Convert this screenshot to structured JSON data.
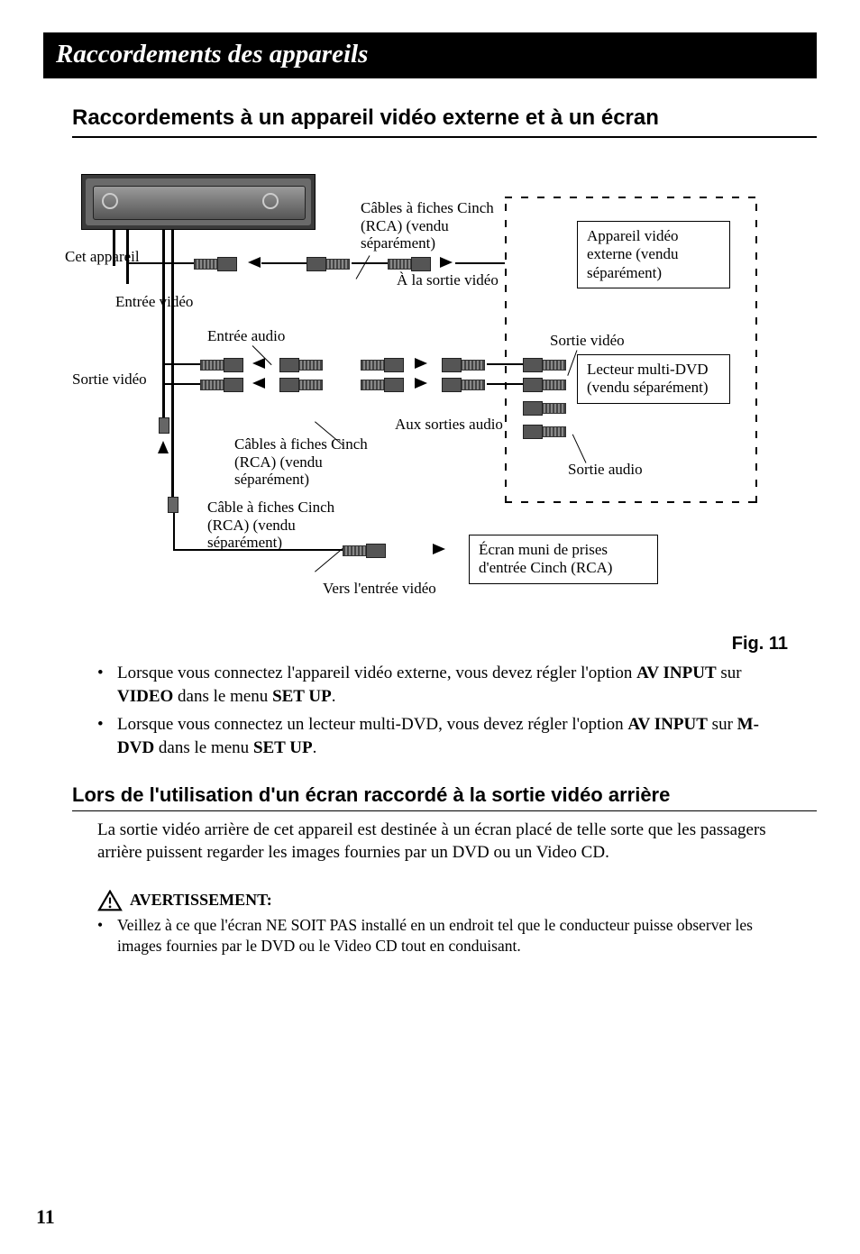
{
  "banner": "Raccordements des appareils",
  "heading1": "Raccordements à un appareil vidéo externe et à un écran",
  "diagram": {
    "this_unit": "Cet appareil",
    "video_in": "Entrée vidéo",
    "audio_in": "Entrée audio",
    "video_out": "Sortie vidéo",
    "audio_out": "Sortie audio",
    "to_video_out": "À la sortie vidéo",
    "to_audio_out": "Aux sorties audio",
    "to_video_in": "Vers l'entrée vidéo",
    "rca_cables_plural": "Câbles à fiches Cinch (RCA) (vendu séparément)",
    "rca_cable_singular": "Câble à fiches Cinch (RCA) (vendu séparément)",
    "external_video_device": "Appareil vidéo externe (vendu séparément)",
    "multi_dvd_player": "Lecteur multi-DVD (vendu séparément)",
    "rca_display": "Écran muni de prises d'entrée Cinch (RCA)"
  },
  "figure_label": "Fig. 11",
  "bullet1_pre": "Lorsque vous connectez l'appareil vidéo externe, vous devez régler l'option ",
  "bullet1_b1": "AV INPUT",
  "bullet1_mid": " sur ",
  "bullet1_b2": "VIDEO",
  "bullet1_mid2": " dans le menu ",
  "bullet1_b3": "SET UP",
  "bullet1_end": ".",
  "bullet2_pre": "Lorsque vous connectez un lecteur multi-DVD, vous devez régler l'option ",
  "bullet2_b1": "AV INPUT",
  "bullet2_mid": " sur ",
  "bullet2_b2": "M-DVD",
  "bullet2_mid2": " dans le menu ",
  "bullet2_b3": "SET UP",
  "bullet2_end": ".",
  "heading2": "Lors de l'utilisation d'un écran raccordé à la sortie vidéo arrière",
  "body_para": "La sortie vidéo arrière de cet appareil est destinée à un écran placé de telle sorte que les passagers arrière puissent regarder les images fournies par un DVD ou un Video CD.",
  "warning_label": "AVERTISSEMENT:",
  "warning_bullet": "Veillez à ce que l'écran NE SOIT PAS installé en un endroit tel que le conducteur puisse observer les images fournies par le DVD ou le Video CD tout en conduisant.",
  "page_number": "11"
}
